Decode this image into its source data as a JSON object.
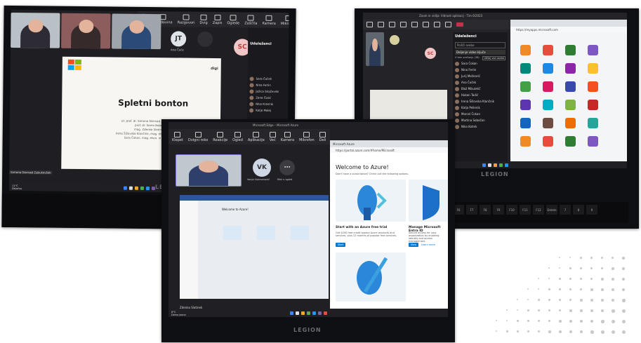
{
  "left_photo": {
    "toolbar": [
      "Chat",
      "Zgodovina",
      "Razgovori",
      "Dvig",
      "Zapis",
      "Oglede",
      "Zaščita",
      "Kamera",
      "Mikrofon",
      "Deljenje"
    ],
    "avatar_initials_1": "JT",
    "avatar_label_1": "Ana Čoče",
    "avatar_initials_2": "SC",
    "panel_title": "Udeleženci",
    "participants": [
      "Sara Čoček",
      "Nina Ferlin",
      "Jožica Stojčevski",
      "Zana Čosić",
      "Nika Krasnik",
      "Katja Malej"
    ],
    "slide_title": "Spletni bonton",
    "slide_lines": [
      "izr. prof. dr. Simona Sternad Zabukovšek",
      "prof. dr. Samo Bobek",
      "mag. Zdenka Slatinek",
      "Irena Šišovska Klančnik, mag. ekon. in posl. ved",
      "Sara Čokan, mag. ekon. in posl. ved"
    ],
    "slide_watermark": "digi",
    "presenter_label": "Simona Sternad Zabukovšek",
    "taskbar_label": "Deljenje",
    "weather_temp": "11°C",
    "weather_text": "Oblačno",
    "legion": "LEGION"
  },
  "right_photo": {
    "window_title": "Zoom in vidlja: Vidnost aplikacij - Tim 6/2023",
    "avatar_initials": "SC",
    "panel_title": "Udeleženci",
    "search_label": "Poišči osebe",
    "share_label": "Deljenje video ključa",
    "section_label": "V tem srečanju (36)",
    "mute_all": "Utišaj vse osebe",
    "participants": [
      "Sara Čokan",
      "Nina Ferlin",
      "Jurij Mežnarić",
      "Ana Čoček",
      "Blaž Mikuletič",
      "Hakan Tadić",
      "Irena Šišovska Klančnik",
      "Katja Pellenik",
      "Marcel Čokan",
      "Martina Sobočan",
      "Nika Kotnik"
    ],
    "browser_url": "https://myapps.microsoft.com",
    "legion": "LEGION",
    "function_keys": [
      "F6",
      "F7",
      "F8",
      "F9",
      "F10",
      "F11",
      "F12",
      "Delete",
      "7",
      "8",
      "9"
    ]
  },
  "front_photo": {
    "window_title": "Microsoft Edge – Microsoft Azure",
    "toolbar": [
      "Klepet",
      "Dvigni roko",
      "Reakcije",
      "Ogled",
      "Aplikacije",
      "Več",
      "Kamera",
      "Mikrofon",
      "Deli"
    ],
    "avatar_initials": "VK",
    "avatar_label": "Vanja Vukmanović",
    "more_label": "Mini v ogled",
    "tab_label": "Microsoft Azure",
    "address": "https://portal.azure.com/#home/Microsoft",
    "azure_title": "Welcome to Azure!",
    "azure_subtitle": "Don't have a subscription? Check out the following options.",
    "card1_title": "Start with an Azure free trial",
    "card1_text": "Get $200 free credit toward Azure products and services, plus 12 months of popular free services.",
    "card1_button": "Start",
    "card2_title": "Manage Microsoft Entra ID",
    "card2_text": "Secure access for your organization by enabling identity and access management.",
    "card2_button": "View",
    "card2_link": "Learn more",
    "inner_slide_title": "Welcome to Azure!",
    "presenter_label": "Zdenka Slatinek",
    "weather_temp": "6°C",
    "weather_text": "Delno jasno",
    "legion": "LEGION"
  }
}
